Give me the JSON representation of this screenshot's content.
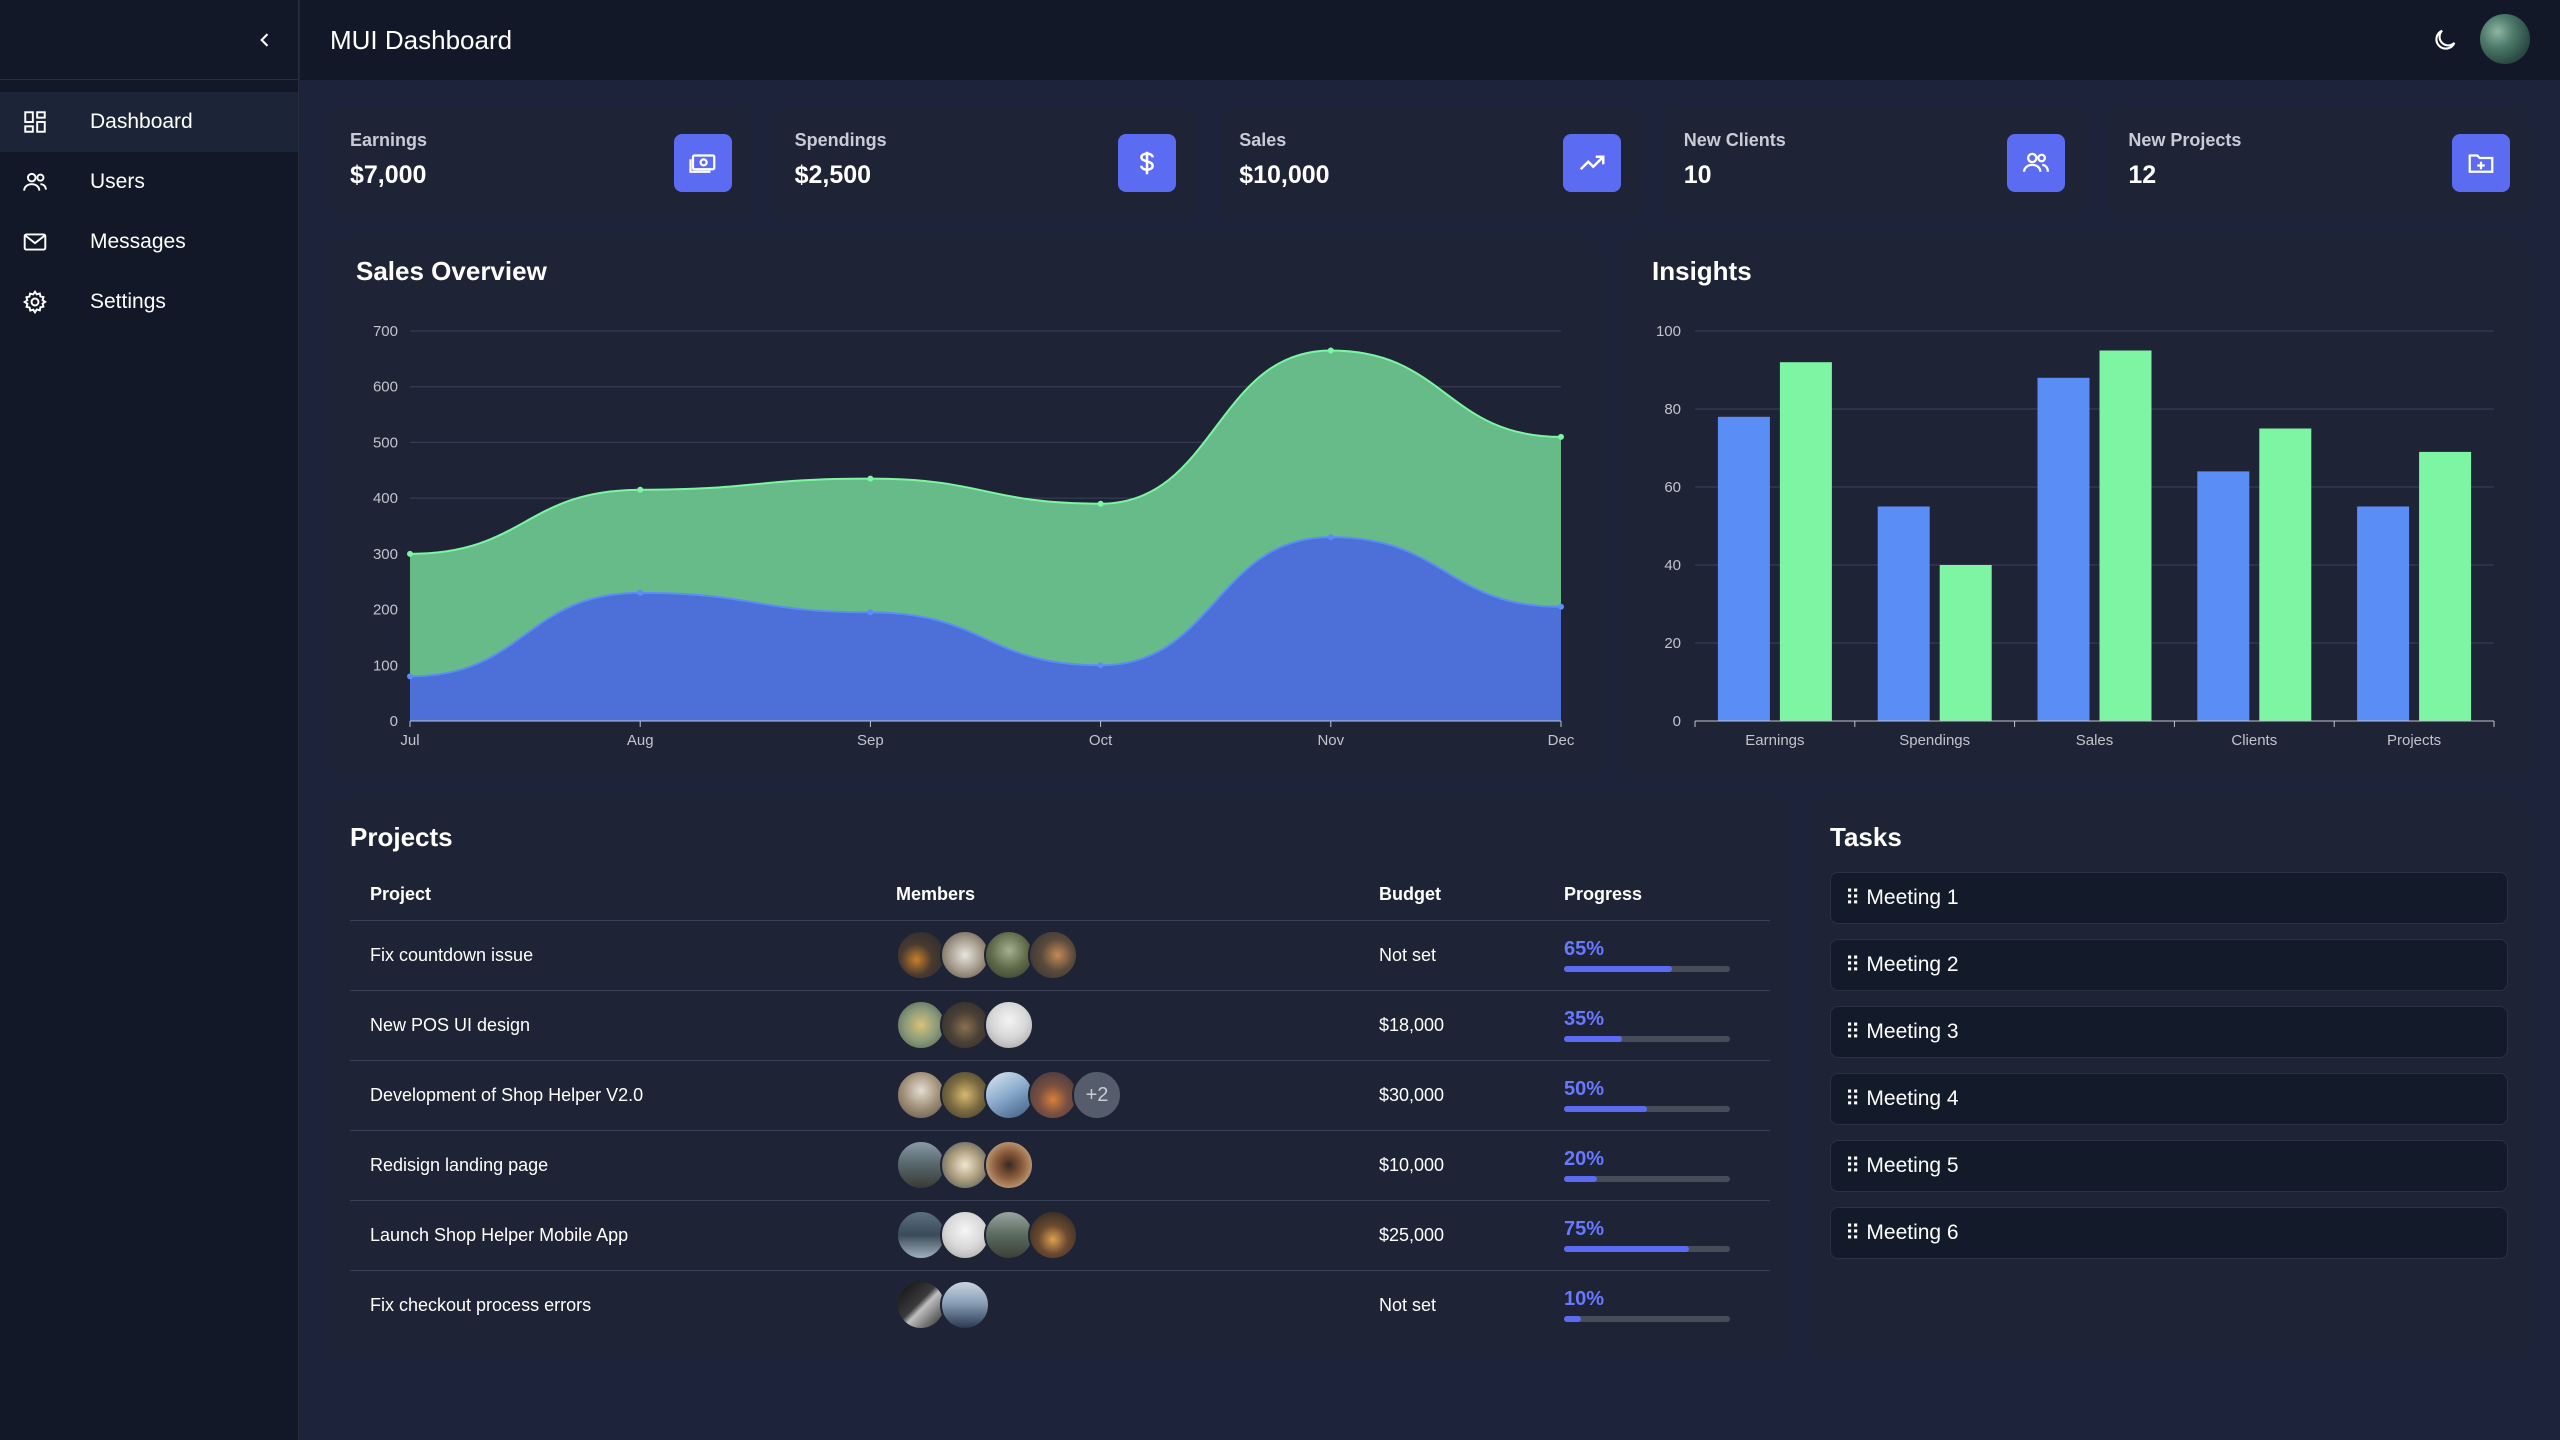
{
  "app": {
    "title": "MUI Dashboard"
  },
  "sidebar": {
    "items": [
      {
        "label": "Dashboard",
        "icon": "dashboard-icon"
      },
      {
        "label": "Users",
        "icon": "users-icon"
      },
      {
        "label": "Messages",
        "icon": "mail-icon"
      },
      {
        "label": "Settings",
        "icon": "gear-icon"
      }
    ]
  },
  "stats": [
    {
      "label": "Earnings",
      "value": "$7,000",
      "icon": "money-icon"
    },
    {
      "label": "Spendings",
      "value": "$2,500",
      "icon": "dollar-icon"
    },
    {
      "label": "Sales",
      "value": "$10,000",
      "icon": "trending-up-icon"
    },
    {
      "label": "New Clients",
      "value": "10",
      "icon": "people-icon"
    },
    {
      "label": "New Projects",
      "value": "12",
      "icon": "folder-add-icon"
    }
  ],
  "sales_overview": {
    "title": "Sales Overview"
  },
  "insights": {
    "title": "Insights"
  },
  "chart_data": [
    {
      "type": "area",
      "title": "Sales Overview",
      "categories": [
        "Jul",
        "Aug",
        "Sep",
        "Oct",
        "Nov",
        "Dec"
      ],
      "ylim": [
        0,
        700
      ],
      "yticks": [
        0,
        100,
        200,
        300,
        400,
        500,
        600,
        700
      ],
      "grid": true,
      "colors": [
        "#4c6fd8",
        "#66bb88"
      ],
      "series": [
        {
          "values": [
            80,
            230,
            195,
            100,
            330,
            205
          ]
        },
        {
          "values": [
            300,
            415,
            435,
            390,
            665,
            510
          ]
        }
      ]
    },
    {
      "type": "bar",
      "title": "Insights",
      "categories": [
        "Earnings",
        "Spendings",
        "Sales",
        "Clients",
        "Projects"
      ],
      "ylim": [
        0,
        100
      ],
      "yticks": [
        0,
        20,
        40,
        60,
        80,
        100
      ],
      "grid": true,
      "colors": [
        "#5b8df7",
        "#7df5a3"
      ],
      "series": [
        {
          "values": [
            78,
            55,
            88,
            64,
            55
          ]
        },
        {
          "values": [
            92,
            40,
            95,
            75,
            69
          ]
        }
      ]
    }
  ],
  "projects": {
    "title": "Projects",
    "columns": [
      "Project",
      "Members",
      "Budget",
      "Progress"
    ],
    "rows": [
      {
        "name": "Fix countdown issue",
        "members": 4,
        "extra": "",
        "budget": "Not set",
        "progress": "65%",
        "progress_value": 0.65
      },
      {
        "name": "New POS UI design",
        "members": 3,
        "extra": "",
        "budget": "$18,000",
        "progress": "35%",
        "progress_value": 0.35
      },
      {
        "name": "Development of Shop Helper V2.0",
        "members": 4,
        "extra": "+2",
        "budget": "$30,000",
        "progress": "50%",
        "progress_value": 0.5
      },
      {
        "name": "Redisign landing page",
        "members": 3,
        "extra": "",
        "budget": "$10,000",
        "progress": "20%",
        "progress_value": 0.2
      },
      {
        "name": "Launch Shop Helper Mobile App",
        "members": 4,
        "extra": "",
        "budget": "$25,000",
        "progress": "75%",
        "progress_value": 0.75
      },
      {
        "name": "Fix checkout process errors",
        "members": 2,
        "extra": "",
        "budget": "Not set",
        "progress": "10%",
        "progress_value": 0.1
      }
    ]
  },
  "tasks": {
    "title": "Tasks",
    "items": [
      "Meeting 1",
      "Meeting 2",
      "Meeting 3",
      "Meeting 4",
      "Meeting 5",
      "Meeting 6"
    ]
  },
  "colors": {
    "accent": "#5b6cf3",
    "background": "#1c233b",
    "card": "#1e2435",
    "sidebar": "#121827"
  }
}
